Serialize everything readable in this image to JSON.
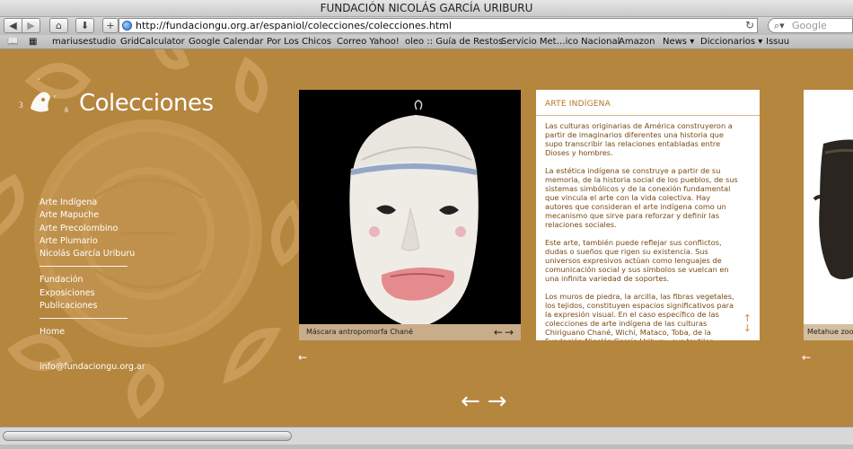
{
  "browser": {
    "window_title": "FUNDACIÓN NICOLÁS GARCÍA URIBURU",
    "url": "http://fundaciongu.org.ar/espaniol/colecciones/colecciones.html",
    "search_placeholder": "Google",
    "bookmarks": [
      "mariusestudio",
      "GridCalculator",
      "Google Calendar",
      "Por Los Chicos",
      "Correo Yahoo!",
      "oleo :: Guía de Restos",
      "Servicio Met…ico Nacional",
      "Amazon",
      "News ▾",
      "Diccionarios ▾",
      "Issuu"
    ]
  },
  "page": {
    "title": "Colecciones",
    "menu_group1": [
      "Arte Indígena",
      "Arte Mapuche",
      "Arte Precolombino",
      "Arte Plumario",
      "Nicolás García Uriburu"
    ],
    "menu_group2": [
      "Fundación",
      "Exposiciones",
      "Publicaciones"
    ],
    "menu_group3": [
      "Home"
    ],
    "email": "info@fundaciongu.org.ar",
    "photo_caption": "Máscara antropomorfa Chané",
    "right_caption": "Metahue zoom",
    "section_heading": "ARTE INDÍGENA",
    "paragraphs": [
      "Las culturas originarias de América construyeron a partir de imaginarios diferentes una historia que supo transcribir las relaciones entabladas entre Dioses y hombres.",
      "La estética indígena se construye a partir de su memoria, de la historia social de los pueblos, de sus sistemas simbólicos y de la conexión fundamental que vincula el arte con la vida colectiva. Hay autores que consideran el arte indígena como un mecanismo que sirve para reforzar y definir las relaciones sociales.",
      "Este arte, también puede reflejar sus conflictos, dudas o sueños que rigen su existencia. Sus universos expresivos actúan como lenguajes de comunicación social y sus símbolos se vuelcan en una infinita variedad de soportes.",
      "Los muros de piedra, la arcilla, las fibras vegetales, los tejidos, constituyen espacios significativos para la expresión visual. En el caso específico de las colecciones de arte indígena de las culturas Chiriguano Chané, Wichí, Mataco, Toba, de la Fundación Nicolás García Uriburu, sus textiles, máscaras, objetos rituales y de uso cotidiano, nos"
    ]
  }
}
